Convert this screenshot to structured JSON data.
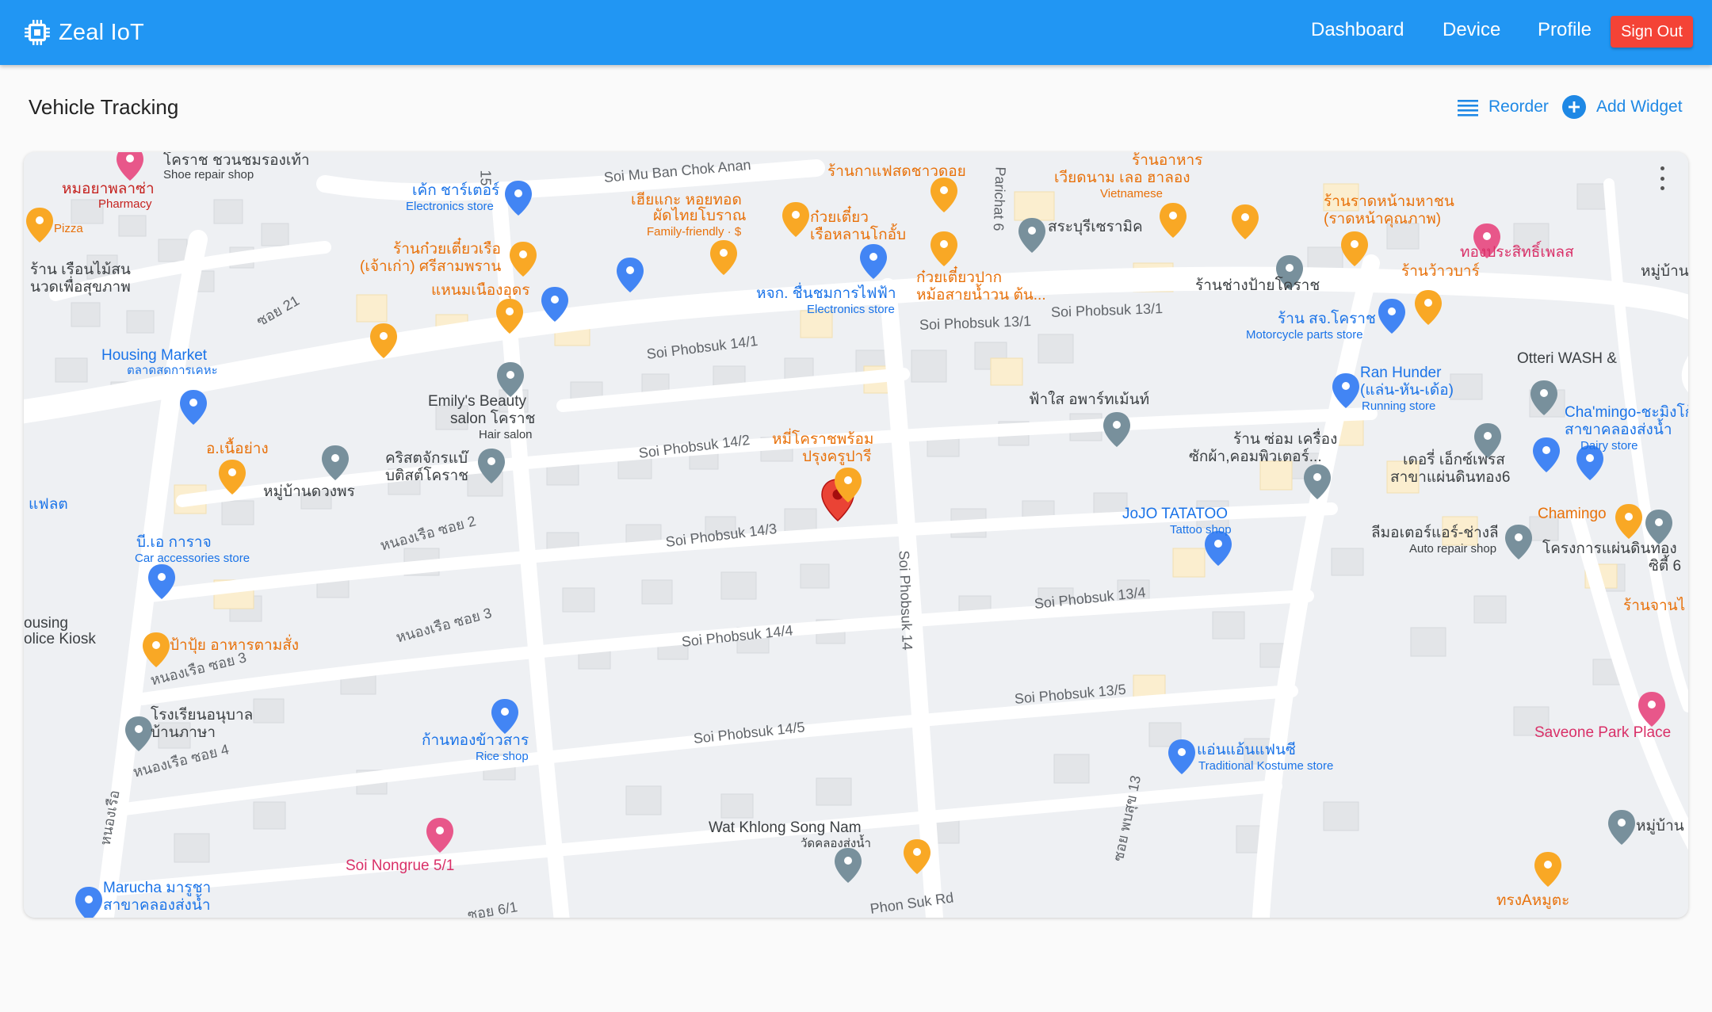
{
  "app": {
    "title": "Zeal IoT"
  },
  "nav": {
    "dashboard": "Dashboard",
    "device": "Device",
    "profile": "Profile",
    "sign_out": "Sign Out"
  },
  "page": {
    "title": "Vehicle Tracking",
    "reorder_label": "Reorder",
    "add_widget_label": "Add Widget"
  },
  "colors": {
    "primary": "#2196f3",
    "danger": "#f44336",
    "marker": "#ea4335",
    "food_pin": "#f9a825",
    "shop_pin": "#4285f4",
    "place_pin": "#78909c",
    "hotel_pin": "#e8578a"
  },
  "map": {
    "streets": [
      "Soi Mu Ban Chok Anan",
      "Soi Phobsuk 13/1",
      "Soi Phobsuk 13/1",
      "Soi Phobsuk 14/1",
      "Soi Phobsuk 14/2",
      "Soi Phobsuk 14/3",
      "Soi Phobsuk 14/4",
      "Soi Phobsuk 14/5",
      "Soi Phobsuk 13/4",
      "Soi Phobsuk 13/5",
      "Soi Phobsuk 14",
      "Phon Suk Rd",
      "Parichat 6",
      "ซอย 21",
      "หนองเรือ ซอย 2",
      "หนองเรือ ซอย 3",
      "หนองเรือ ซอย 3",
      "หนองเรือ ซอย 4",
      "ซอย 6/1",
      "หนองเรือ",
      "ซอย พบสุข 13",
      "15"
    ],
    "places": [
      {
        "name": "โคราช ชวนชมรองเท้า",
        "category": "Shoe repair shop"
      },
      {
        "name": "หมอยาพลาซ่า",
        "category": "Pharmacy"
      },
      {
        "name": "Pizza",
        "category": ""
      },
      {
        "name": "ร้าน เรือนไม้สน",
        "category": ""
      },
      {
        "name": "นวดเพื่อสุขภาพ",
        "category": ""
      },
      {
        "name": "เค้ก ชาร์เตอร์",
        "category": "Electronics store"
      },
      {
        "name": "ร้านก๋วยเตี๋ยวเรือ",
        "category": ""
      },
      {
        "name": "(เจ้าเก่า) ศรีสามพราน",
        "category": ""
      },
      {
        "name": "แหนมเนืองอุดร",
        "category": ""
      },
      {
        "name": "เฮียแกะ หอยทอด",
        "category": ""
      },
      {
        "name": "ผัดไทยโบราณ",
        "category": "Family-friendly · $"
      },
      {
        "name": "ร้านกาแฟสดชาวดอย",
        "category": ""
      },
      {
        "name": "ก๋วยเตี๋ยว",
        "category": ""
      },
      {
        "name": "เรือหลานโกอั้บ",
        "category": ""
      },
      {
        "name": "หจก. ชื่นชมการไฟฟ้า",
        "category": "Electronics store"
      },
      {
        "name": "ก๋วยเตี๋ยวปาก",
        "category": ""
      },
      {
        "name": "หม้อสายน้ำวน ต้น...",
        "category": ""
      },
      {
        "name": "สระบุรีเซรามิค",
        "category": ""
      },
      {
        "name": "ร้านอาหาร",
        "category": ""
      },
      {
        "name": "เวียดนาม เลอ ฮาลอง",
        "category": "Vietnamese"
      },
      {
        "name": "ร้านราดหน้ามหาชน",
        "category": ""
      },
      {
        "name": "(ราดหน้าคุณภาพ)",
        "category": ""
      },
      {
        "name": "ทองประสิทธิ์เพลส",
        "category": ""
      },
      {
        "name": "ร้านช่างป้ายโคราช",
        "category": ""
      },
      {
        "name": "ร้านว้าวบาร์",
        "category": ""
      },
      {
        "name": "ร้าน สจ.โคราช",
        "category": "Motorcycle parts store"
      },
      {
        "name": "หมู่บ้าน",
        "category": ""
      },
      {
        "name": "Housing Market",
        "category": "ตลาดสดการเคหะ"
      },
      {
        "name": "Emily's Beauty",
        "category": ""
      },
      {
        "name": "salon โคราช",
        "category": "Hair salon"
      },
      {
        "name": "Ran Hunder",
        "category": ""
      },
      {
        "name": "(แล่น-หัน-เด้อ)",
        "category": "Running store"
      },
      {
        "name": "Otteri WASH &",
        "category": ""
      },
      {
        "name": "Cha'mingo-ชะมิงโก้",
        "category": ""
      },
      {
        "name": "สาขาคลองส่งน้ำ",
        "category": "Dairy store"
      },
      {
        "name": "อ.เนื้อย่าง",
        "category": ""
      },
      {
        "name": "คริสตจักรแบ๊",
        "category": ""
      },
      {
        "name": "บติสต์โคราช",
        "category": ""
      },
      {
        "name": "หมู่บ้านดวงพร",
        "category": ""
      },
      {
        "name": "ฟ้าใส อพาร์ทเม้นท์",
        "category": ""
      },
      {
        "name": "หมี่โคราชพร้อม",
        "category": ""
      },
      {
        "name": "ปรุงครูปารี",
        "category": ""
      },
      {
        "name": "ร้าน ซ่อม เครื่อง",
        "category": ""
      },
      {
        "name": "ซักผ้า,คอมพิวเตอร์...",
        "category": ""
      },
      {
        "name": "เดอรี่ เอ็กซ์เพรส",
        "category": ""
      },
      {
        "name": "สาขาแผ่นดินทอง6",
        "category": ""
      },
      {
        "name": "Chamingo",
        "category": ""
      },
      {
        "name": "JoJO TATATOO",
        "category": "Tattoo shop"
      },
      {
        "name": "ลีมอเตอร์แอร์-ช่างลี",
        "category": "Auto repair shop"
      },
      {
        "name": "โครงการแผ่นดินทอง",
        "category": ""
      },
      {
        "name": "ซิตี้ 6",
        "category": ""
      },
      {
        "name": "แฟลต",
        "category": ""
      },
      {
        "name": "บี.เอ การาจ",
        "category": "Car accessories store"
      },
      {
        "name": "ousing",
        "category": ""
      },
      {
        "name": "olice Kiosk",
        "category": ""
      },
      {
        "name": "ป้าปุ้ย อาหารตามสั่ง",
        "category": ""
      },
      {
        "name": "โรงเรียนอนุบาล",
        "category": ""
      },
      {
        "name": "บ้านภาษา",
        "category": ""
      },
      {
        "name": "ก้านทองข้าวสาร",
        "category": "Rice shop"
      },
      {
        "name": "ร้านจานไ",
        "category": ""
      },
      {
        "name": "Saveone Park Place",
        "category": ""
      },
      {
        "name": "แอ่นแอ้นแฟนซี",
        "category": "Traditional Kostume store"
      },
      {
        "name": "Wat Khlong Song Nam",
        "category": "วัดคลองส่งน้ำ"
      },
      {
        "name": "Soi Nongrue 5/1",
        "category": ""
      },
      {
        "name": "Marucha มารูชา",
        "category": ""
      },
      {
        "name": "สาขาคลองส่งน้ำ",
        "category": ""
      },
      {
        "name": "หมู่บ้าน",
        "category": ""
      },
      {
        "name": "ทรงAหมูตะ",
        "category": ""
      }
    ],
    "vehicle_marker": "vehicle-location"
  }
}
